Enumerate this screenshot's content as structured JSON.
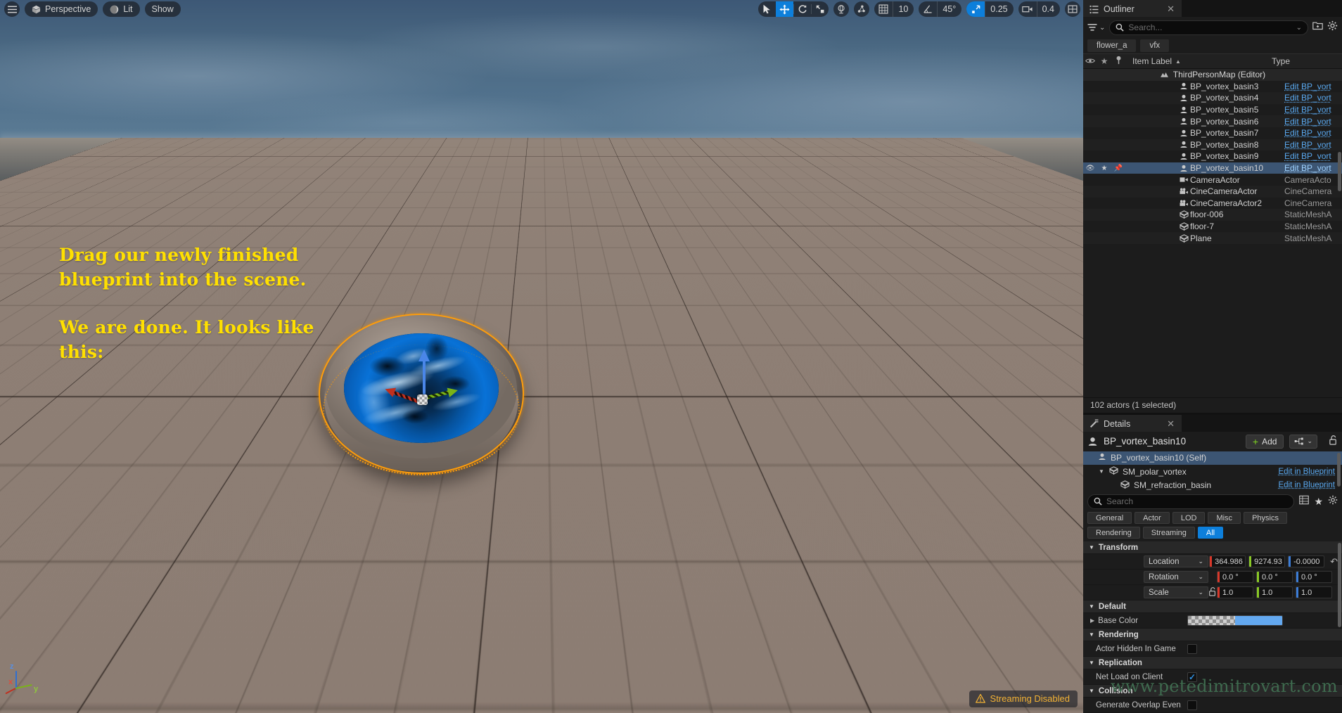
{
  "viewport": {
    "toolbar": {
      "menu_icon": "hamburger-menu-icon",
      "perspective_label": "Perspective",
      "perspective_icon": "cube-icon",
      "lit_label": "Lit",
      "lit_icon": "lighting-sphere-icon",
      "show_label": "Show",
      "tools": [
        {
          "name": "select-tool",
          "icon": "cursor-arrow-icon",
          "active": false
        },
        {
          "name": "move-tool",
          "icon": "move-arrows-icon",
          "active": true
        },
        {
          "name": "rotate-tool",
          "icon": "rotate-icon",
          "active": false
        },
        {
          "name": "scale-tool",
          "icon": "scale-icon",
          "active": false
        }
      ],
      "coord_system_icon": "world-axes-icon",
      "surface_snap_icon": "surface-snap-icon",
      "grid_snap": {
        "icon": "grid-icon",
        "value": "10",
        "enabled": false
      },
      "angle_snap": {
        "icon": "angle-icon",
        "value": "45°",
        "enabled": false
      },
      "scale_snap": {
        "icon": "scale-snap-icon",
        "value": "0.25",
        "enabled": true
      },
      "camera_speed": {
        "icon": "camera-icon",
        "value": "0.4"
      },
      "layouts_icon": "viewport-layouts-icon"
    },
    "annotations": [
      {
        "name": "annotation-drag-blueprint",
        "text": "Drag our newly finished\nblueprint into the scene."
      },
      {
        "name": "annotation-we-are-done",
        "text": "We are done. It looks like\nthis:"
      }
    ],
    "axis_indicator": {
      "x": "x",
      "y": "y",
      "z": "z"
    },
    "status": {
      "icon": "warning-triangle-icon",
      "text": "Streaming Disabled"
    }
  },
  "outliner": {
    "tab_label": "Outliner",
    "tab_icon": "outliner-icon",
    "close_icon": "close-icon",
    "filter_icon": "filter-icon",
    "search_placeholder": "Search...",
    "search_value": "",
    "new_folder_icon": "new-folder-icon",
    "settings_icon": "gear-icon",
    "breadcrumbs": [
      "flower_a",
      "vfx"
    ],
    "columns": {
      "visibility_icon": "eye-icon",
      "star_icon": "star-icon",
      "pin_icon": "pin-icon",
      "item_label": "Item Label",
      "sort_icon": "sort-ascending-icon",
      "type": "Type"
    },
    "world_row": {
      "icon": "level-icon",
      "label": "ThirdPersonMap (Editor)"
    },
    "rows": [
      {
        "name": "BP_vortex_basin3",
        "type": "Edit BP_vort",
        "icon": "blueprint-actor-icon",
        "link": true,
        "selected": false
      },
      {
        "name": "BP_vortex_basin4",
        "type": "Edit BP_vort",
        "icon": "blueprint-actor-icon",
        "link": true,
        "selected": false
      },
      {
        "name": "BP_vortex_basin5",
        "type": "Edit BP_vort",
        "icon": "blueprint-actor-icon",
        "link": true,
        "selected": false
      },
      {
        "name": "BP_vortex_basin6",
        "type": "Edit BP_vort",
        "icon": "blueprint-actor-icon",
        "link": true,
        "selected": false
      },
      {
        "name": "BP_vortex_basin7",
        "type": "Edit BP_vort",
        "icon": "blueprint-actor-icon",
        "link": true,
        "selected": false
      },
      {
        "name": "BP_vortex_basin8",
        "type": "Edit BP_vort",
        "icon": "blueprint-actor-icon",
        "link": true,
        "selected": false
      },
      {
        "name": "BP_vortex_basin9",
        "type": "Edit BP_vort",
        "icon": "blueprint-actor-icon",
        "link": true,
        "selected": false
      },
      {
        "name": "BP_vortex_basin10",
        "type": "Edit BP_vort",
        "icon": "blueprint-actor-icon",
        "link": true,
        "selected": true
      },
      {
        "name": "CameraActor",
        "type": "CameraActo",
        "icon": "camera-actor-icon",
        "link": false,
        "selected": false
      },
      {
        "name": "CineCameraActor",
        "type": "CineCamera",
        "icon": "cine-camera-icon",
        "link": false,
        "selected": false
      },
      {
        "name": "CineCameraActor2",
        "type": "CineCamera",
        "icon": "cine-camera-icon",
        "link": false,
        "selected": false
      },
      {
        "name": "floor-006",
        "type": "StaticMeshA",
        "icon": "static-mesh-icon",
        "link": false,
        "selected": false
      },
      {
        "name": "floor-7",
        "type": "StaticMeshA",
        "icon": "static-mesh-icon",
        "link": false,
        "selected": false
      },
      {
        "name": "Plane",
        "type": "StaticMeshA",
        "icon": "static-mesh-icon",
        "link": false,
        "selected": false
      }
    ],
    "status": "102 actors (1 selected)"
  },
  "details": {
    "tab_label": "Details",
    "tab_icon": "details-icon",
    "close_icon": "close-icon",
    "actor_name": "BP_vortex_basin10",
    "actor_icon": "blueprint-actor-icon",
    "add_label": "Add",
    "blueprint_menu_icon": "blueprint-graph-icon",
    "chevron_icon": "chevron-down-icon",
    "lock_icon": "unlocked-icon",
    "components": [
      {
        "label": "BP_vortex_basin10 (Self)",
        "icon": "blueprint-actor-icon",
        "link": "",
        "selected": true,
        "depth": 0,
        "expander": ""
      },
      {
        "label": "SM_polar_vortex",
        "icon": "static-mesh-icon",
        "link": "Edit in Blueprint",
        "selected": false,
        "depth": 1,
        "expander": "▼"
      },
      {
        "label": "SM_refraction_basin",
        "icon": "static-mesh-icon",
        "link": "Edit in Blueprint",
        "selected": false,
        "depth": 2,
        "expander": ""
      }
    ],
    "search_placeholder": "Search",
    "search_value": "",
    "column_icon": "columns-icon",
    "favorite_icon": "star-icon",
    "settings_icon": "gear-icon",
    "filter_chips": [
      {
        "label": "General",
        "active": false
      },
      {
        "label": "Actor",
        "active": false
      },
      {
        "label": "LOD",
        "active": false
      },
      {
        "label": "Misc",
        "active": false
      },
      {
        "label": "Physics",
        "active": false
      },
      {
        "label": "Rendering",
        "active": false
      },
      {
        "label": "Streaming",
        "active": false
      },
      {
        "label": "All",
        "active": true
      }
    ],
    "sections": {
      "transform": {
        "title": "Transform",
        "rows": [
          {
            "label": "Location",
            "dropdown": true,
            "lock": false,
            "values": [
              "364.986",
              "9274.93",
              "-0.0000"
            ],
            "reset": "↶"
          },
          {
            "label": "Rotation",
            "dropdown": true,
            "lock": false,
            "values": [
              "0.0 °",
              "0.0 °",
              "0.0 °"
            ],
            "reset": ""
          },
          {
            "label": "Scale",
            "dropdown": true,
            "lock": true,
            "values": [
              "1.0",
              "1.0",
              "1.0"
            ],
            "reset": ""
          }
        ]
      },
      "default": {
        "title": "Default",
        "base_color_label": "Base Color",
        "base_color_hex": "#63a8ef",
        "expander": "▶"
      },
      "rendering": {
        "title": "Rendering",
        "actor_hidden_label": "Actor Hidden In Game",
        "actor_hidden_checked": false
      },
      "replication": {
        "title": "Replication",
        "net_load_label": "Net Load on Client",
        "net_load_checked": true
      },
      "collision": {
        "title": "Collision",
        "overlap_label": "Generate Overlap Even...",
        "overlap_checked": false
      }
    },
    "watermark": "www.petedimitrovart.com"
  }
}
